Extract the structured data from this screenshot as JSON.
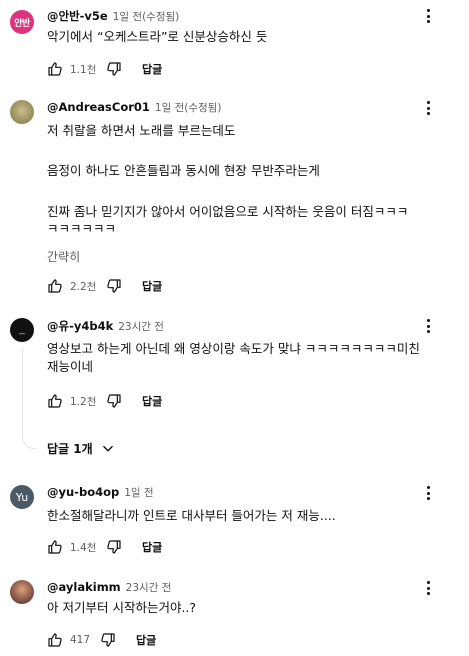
{
  "comments": [
    {
      "author": "@안반-v5e",
      "time": "1일 전(수정됨)",
      "avatar_text": "안반",
      "avatar_color": "#e0337f",
      "lines": [
        "악기에서 “오케스트라”로 신분상승하신 듯"
      ],
      "likes": "1.1천",
      "reply_label": "답글"
    },
    {
      "author": "@AndreasCor01",
      "time": "1일 전(수정됨)",
      "avatar_color": "#a89a6a",
      "lines": [
        "저 취랄을 하면서 노래를 부르는데도",
        "",
        "음정이 하나도 안흔들림과 동시에 현장 무반주라는게",
        "",
        "진짜 좀나 믿기지가 않아서 어이없음으로 시작하는 웃음이 터짐ㅋㅋㅋ",
        "ㅋㅋㅋㅋㅋㅋ"
      ],
      "more_label": "간략히",
      "likes": "2.2천",
      "reply_label": "답글"
    },
    {
      "author": "@유-y4b4k",
      "time": "23시간 전",
      "avatar_color": "#111111",
      "lines": [
        "영상보고 하는게 아닌데 왜 영상이랑 속도가 맞냐 ㅋㅋㅋㅋㅋㅋㅋㅋ미친",
        "재능이네"
      ],
      "likes": "1.2천",
      "reply_label": "답글",
      "replies_toggle_label": "답글 1개"
    },
    {
      "author": "@yu-bo4op",
      "time": "1일 전",
      "avatar_text": "Yu",
      "avatar_color": "#4c5a66",
      "lines": [
        "한소절해달라니까 인트로 대사부터 들어가는 저 재능...."
      ],
      "likes": "1.4천",
      "reply_label": "답글"
    },
    {
      "author": "@aylakimm",
      "time": "23시간 전",
      "avatar_color": "#8a5a4a",
      "lines": [
        "아 저기부터 시작하는거야..?"
      ],
      "likes": "417",
      "reply_label": "답글"
    }
  ],
  "icons": {
    "like": "thumbs-up-outline",
    "dislike": "thumbs-down-outline",
    "menu": "three-dot-vertical",
    "expand": "chevron-down"
  }
}
